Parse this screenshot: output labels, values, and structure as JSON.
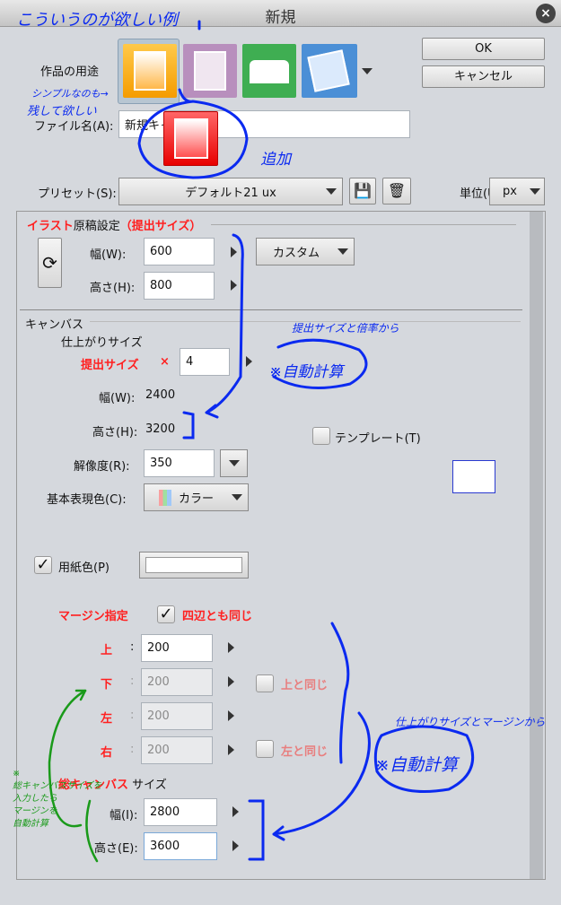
{
  "window": {
    "title": "新規"
  },
  "buttons": {
    "ok": "OK",
    "cancel": "キャンセル"
  },
  "purpose": {
    "label": "作品の用途",
    "icons": [
      "illustration-icon",
      "comic-icon",
      "book-icon",
      "animation-icon"
    ],
    "added_icon": "simple-illustration-icon"
  },
  "file": {
    "label": "ファイル名(A):",
    "value": "新規キャンバス"
  },
  "preset": {
    "label": "プリセット(S):",
    "value": "デフォルト21 ux",
    "unit_label": "単位(U):",
    "unit_value": "px"
  },
  "illust": {
    "title_red1": "イラスト",
    "title_black": "原稿設定",
    "title_red2": "（提出サイズ）",
    "width_label": "幅(W):",
    "width": "600",
    "height_label": "高さ(H):",
    "height": "800",
    "size_preset": "カスタム"
  },
  "canvas": {
    "title": "キャンバス",
    "finish_label": "仕上がりサイズ",
    "submit_label": "提出サイズ",
    "times": "×",
    "scale": "4",
    "width_label": "幅(W):",
    "width": "2400",
    "height_label": "高さ(H):",
    "height": "3200",
    "template_label": "テンプレート(T)",
    "resolution_label": "解像度(R):",
    "resolution": "350",
    "color_label": "基本表現色(C):",
    "color_value": "カラー",
    "paper_label": "用紙色(P)"
  },
  "margin": {
    "title": "マージン指定",
    "same_all": "四辺とも同じ",
    "top_label": "上",
    "bottom_label": "下",
    "left_label": "左",
    "right_label": "右",
    "colon": ":",
    "top": "200",
    "bottom": "200",
    "left": "200",
    "right": "200",
    "same_top": "上と同じ",
    "same_left": "左と同じ"
  },
  "total": {
    "title_red": "総キャンバス",
    "title_black": "サイズ",
    "width_label": "幅(I):",
    "width": "2800",
    "height_label": "高さ(E):",
    "height": "3600"
  },
  "annotations": {
    "want": "こういうのが欲しい例",
    "keep1": "シンプルなのも→",
    "keep2": "残して欲しい",
    "added": "追加",
    "from_scale": "提出サイズと倍率から",
    "auto1": "※自動計算",
    "from_margin": "仕上がりサイズとマージンから",
    "auto2": "※自動計算",
    "green1": "※",
    "green2": "総キャンバスサイズを",
    "green3": "入力したら",
    "green4": "マージンを",
    "green5": "自動計算"
  },
  "colors": {
    "annotation_blue": "#0b2af0",
    "annotation_green": "#1a9a1a",
    "label_red": "#ff2020"
  }
}
